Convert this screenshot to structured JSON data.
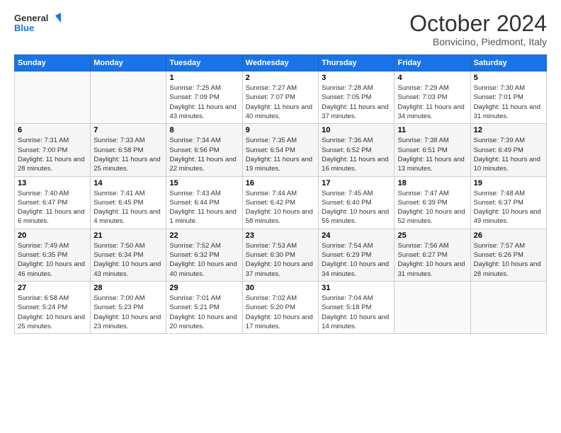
{
  "logo": {
    "line1": "General",
    "line2": "Blue"
  },
  "title": "October 2024",
  "subtitle": "Bonvicino, Piedmont, Italy",
  "weekdays": [
    "Sunday",
    "Monday",
    "Tuesday",
    "Wednesday",
    "Thursday",
    "Friday",
    "Saturday"
  ],
  "weeks": [
    [
      {
        "day": "",
        "info": ""
      },
      {
        "day": "",
        "info": ""
      },
      {
        "day": "1",
        "info": "Sunrise: 7:25 AM\nSunset: 7:09 PM\nDaylight: 11 hours and 43 minutes."
      },
      {
        "day": "2",
        "info": "Sunrise: 7:27 AM\nSunset: 7:07 PM\nDaylight: 11 hours and 40 minutes."
      },
      {
        "day": "3",
        "info": "Sunrise: 7:28 AM\nSunset: 7:05 PM\nDaylight: 11 hours and 37 minutes."
      },
      {
        "day": "4",
        "info": "Sunrise: 7:29 AM\nSunset: 7:03 PM\nDaylight: 11 hours and 34 minutes."
      },
      {
        "day": "5",
        "info": "Sunrise: 7:30 AM\nSunset: 7:01 PM\nDaylight: 11 hours and 31 minutes."
      }
    ],
    [
      {
        "day": "6",
        "info": "Sunrise: 7:31 AM\nSunset: 7:00 PM\nDaylight: 11 hours and 28 minutes."
      },
      {
        "day": "7",
        "info": "Sunrise: 7:33 AM\nSunset: 6:58 PM\nDaylight: 11 hours and 25 minutes."
      },
      {
        "day": "8",
        "info": "Sunrise: 7:34 AM\nSunset: 6:56 PM\nDaylight: 11 hours and 22 minutes."
      },
      {
        "day": "9",
        "info": "Sunrise: 7:35 AM\nSunset: 6:54 PM\nDaylight: 11 hours and 19 minutes."
      },
      {
        "day": "10",
        "info": "Sunrise: 7:36 AM\nSunset: 6:52 PM\nDaylight: 11 hours and 16 minutes."
      },
      {
        "day": "11",
        "info": "Sunrise: 7:38 AM\nSunset: 6:51 PM\nDaylight: 11 hours and 13 minutes."
      },
      {
        "day": "12",
        "info": "Sunrise: 7:39 AM\nSunset: 6:49 PM\nDaylight: 11 hours and 10 minutes."
      }
    ],
    [
      {
        "day": "13",
        "info": "Sunrise: 7:40 AM\nSunset: 6:47 PM\nDaylight: 11 hours and 6 minutes."
      },
      {
        "day": "14",
        "info": "Sunrise: 7:41 AM\nSunset: 6:45 PM\nDaylight: 11 hours and 4 minutes."
      },
      {
        "day": "15",
        "info": "Sunrise: 7:43 AM\nSunset: 6:44 PM\nDaylight: 11 hours and 1 minute."
      },
      {
        "day": "16",
        "info": "Sunrise: 7:44 AM\nSunset: 6:42 PM\nDaylight: 10 hours and 58 minutes."
      },
      {
        "day": "17",
        "info": "Sunrise: 7:45 AM\nSunset: 6:40 PM\nDaylight: 10 hours and 55 minutes."
      },
      {
        "day": "18",
        "info": "Sunrise: 7:47 AM\nSunset: 6:39 PM\nDaylight: 10 hours and 52 minutes."
      },
      {
        "day": "19",
        "info": "Sunrise: 7:48 AM\nSunset: 6:37 PM\nDaylight: 10 hours and 49 minutes."
      }
    ],
    [
      {
        "day": "20",
        "info": "Sunrise: 7:49 AM\nSunset: 6:35 PM\nDaylight: 10 hours and 46 minutes."
      },
      {
        "day": "21",
        "info": "Sunrise: 7:50 AM\nSunset: 6:34 PM\nDaylight: 10 hours and 43 minutes."
      },
      {
        "day": "22",
        "info": "Sunrise: 7:52 AM\nSunset: 6:32 PM\nDaylight: 10 hours and 40 minutes."
      },
      {
        "day": "23",
        "info": "Sunrise: 7:53 AM\nSunset: 6:30 PM\nDaylight: 10 hours and 37 minutes."
      },
      {
        "day": "24",
        "info": "Sunrise: 7:54 AM\nSunset: 6:29 PM\nDaylight: 10 hours and 34 minutes."
      },
      {
        "day": "25",
        "info": "Sunrise: 7:56 AM\nSunset: 6:27 PM\nDaylight: 10 hours and 31 minutes."
      },
      {
        "day": "26",
        "info": "Sunrise: 7:57 AM\nSunset: 6:26 PM\nDaylight: 10 hours and 28 minutes."
      }
    ],
    [
      {
        "day": "27",
        "info": "Sunrise: 6:58 AM\nSunset: 5:24 PM\nDaylight: 10 hours and 25 minutes."
      },
      {
        "day": "28",
        "info": "Sunrise: 7:00 AM\nSunset: 5:23 PM\nDaylight: 10 hours and 23 minutes."
      },
      {
        "day": "29",
        "info": "Sunrise: 7:01 AM\nSunset: 5:21 PM\nDaylight: 10 hours and 20 minutes."
      },
      {
        "day": "30",
        "info": "Sunrise: 7:02 AM\nSunset: 5:20 PM\nDaylight: 10 hours and 17 minutes."
      },
      {
        "day": "31",
        "info": "Sunrise: 7:04 AM\nSunset: 5:18 PM\nDaylight: 10 hours and 14 minutes."
      },
      {
        "day": "",
        "info": ""
      },
      {
        "day": "",
        "info": ""
      }
    ]
  ]
}
